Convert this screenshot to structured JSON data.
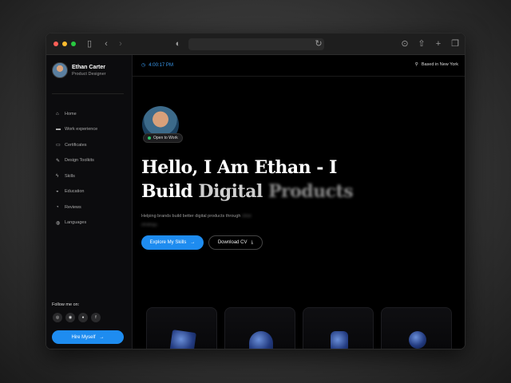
{
  "colors": {
    "accent": "#1e8cf0",
    "traffic": [
      "#ff5f57",
      "#febc2e",
      "#28c840"
    ],
    "online": "#2fc36b"
  },
  "browser": {
    "icons": [
      "sidebar-toggle-icon",
      "back-icon",
      "forward-icon",
      "shield-icon",
      "reload-icon",
      "download-icon",
      "share-icon",
      "new-tab-icon",
      "tabs-overview-icon"
    ]
  },
  "profile": {
    "name": "Ethan Carter",
    "role": "Product Designer"
  },
  "nav": {
    "items": [
      {
        "label": "Home",
        "icon": "home-icon",
        "glyph": "⌂"
      },
      {
        "label": "Work experience",
        "icon": "briefcase-icon",
        "glyph": "▬"
      },
      {
        "label": "Certificates",
        "icon": "certificate-icon",
        "glyph": "▭"
      },
      {
        "label": "Design Toolkits",
        "icon": "brush-icon",
        "glyph": "✎"
      },
      {
        "label": "Skills",
        "icon": "lightning-icon",
        "glyph": "ϟ"
      },
      {
        "label": "Education",
        "icon": "graduation-icon",
        "glyph": "◒"
      },
      {
        "label": "Reviews",
        "icon": "chat-icon",
        "glyph": "◔"
      },
      {
        "label": "Languages",
        "icon": "globe-icon",
        "glyph": "◍"
      }
    ]
  },
  "follow": {
    "label": "Follow me on:",
    "socials": [
      "instagram-icon",
      "dribbble-icon",
      "github-icon",
      "facebook-icon"
    ]
  },
  "hire": {
    "label": "Hire Myself"
  },
  "topbar": {
    "time": "4:00:17 PM",
    "location": "Based in New York"
  },
  "hero": {
    "badge": "Open to Work",
    "line1": "Hello, I Am Ethan - I",
    "line2_a": "Build ",
    "line2_b": "Digital ",
    "line2_c": "Products",
    "subtitle_visible": "Helping brands build better digital products through",
    "subtitle_blurred_1": "clear",
    "subtitle_blurred_2": "strategy.",
    "cta_primary": "Explore My Skills",
    "cta_secondary": "Download CV"
  }
}
